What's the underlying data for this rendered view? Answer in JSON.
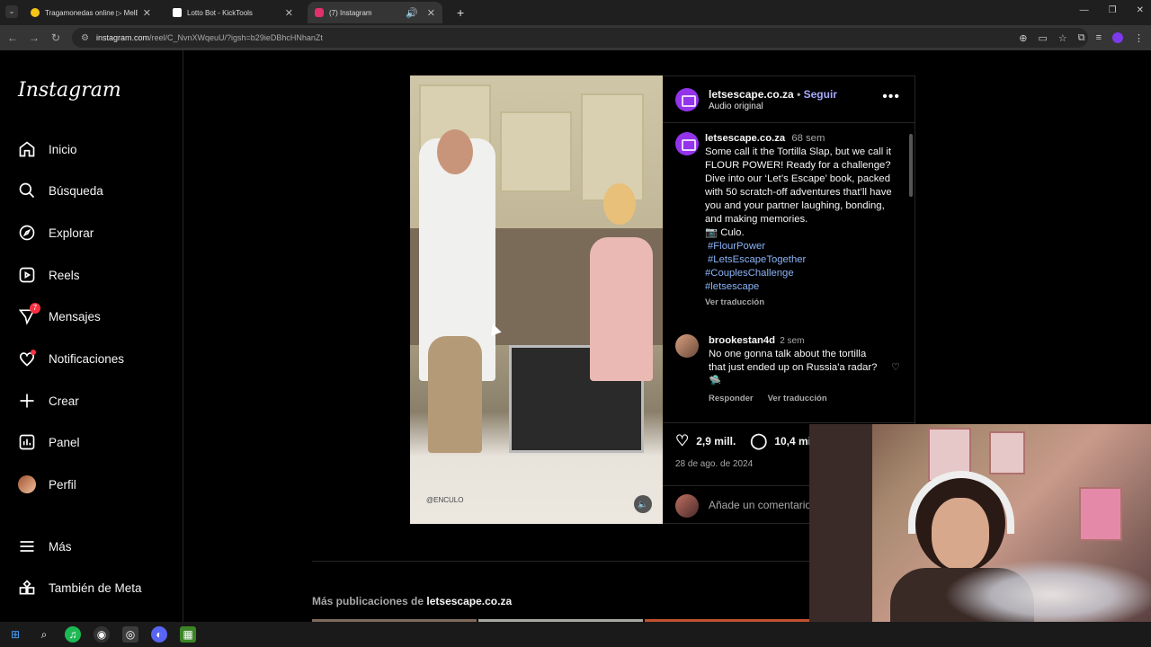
{
  "browser": {
    "tabs": [
      {
        "title": "Tragamonedas online ▷ MelBet",
        "color": "#f5c518"
      },
      {
        "title": "Lotto Bot - KickTools",
        "color": "#ffffff"
      },
      {
        "title": "(7) Instagram",
        "color": "#e1306c"
      }
    ],
    "url_host": "instagram.com",
    "url_path": "/reel/C_NvnXWqeuU/?igsh=b29ieDBhcHNhanZt"
  },
  "sidebar": {
    "logo": "Instagram",
    "items": [
      {
        "label": "Inicio",
        "icon": "home-icon"
      },
      {
        "label": "Búsqueda",
        "icon": "search-icon"
      },
      {
        "label": "Explorar",
        "icon": "compass-icon"
      },
      {
        "label": "Reels",
        "icon": "reels-icon"
      },
      {
        "label": "Mensajes",
        "icon": "messenger-icon",
        "badge": "7"
      },
      {
        "label": "Notificaciones",
        "icon": "heart-icon"
      },
      {
        "label": "Crear",
        "icon": "plus-icon"
      },
      {
        "label": "Panel",
        "icon": "dashboard-icon"
      },
      {
        "label": "Perfil",
        "icon": "avatar"
      },
      {
        "label": "Más",
        "icon": "menu-icon"
      },
      {
        "label": "También de Meta",
        "icon": "meta-icon"
      }
    ]
  },
  "post": {
    "account": "letsescape.co.za",
    "follow": "Seguir",
    "audio": "Audio original",
    "caption_time": "68 sem",
    "caption_text": "Some call it the Tortilla Slap, but we call it FLOUR POWER! Ready for a challenge? Dive into our ‘Let’s Escape’ book, packed with 50 scratch-off adventures that’ll have you and your partner laughing, bonding, and making memories.",
    "caption_credit": "📷 Culo.",
    "hashtags": [
      "#FlourPower",
      "#LetsEscapeTogether",
      "#CouplesChallenge",
      "#letsescape"
    ],
    "translate": "Ver traducción",
    "watermark": "@ENCULO",
    "comment": {
      "user": "brookestan4d",
      "time": "2 sem",
      "text": "No one gonna talk about the tortilla that just ended up on Russia'a radar? 🛸",
      "reply": "Responder",
      "translate": "Ver traducción"
    },
    "likes": "2,9 mill.",
    "comments": "10,4 mil",
    "date": "28 de ago. de 2024",
    "add_comment_placeholder": "Añade un comentario..."
  },
  "more_posts": {
    "prefix": "Más publicaciones de",
    "account": "letsescape.co.za"
  }
}
